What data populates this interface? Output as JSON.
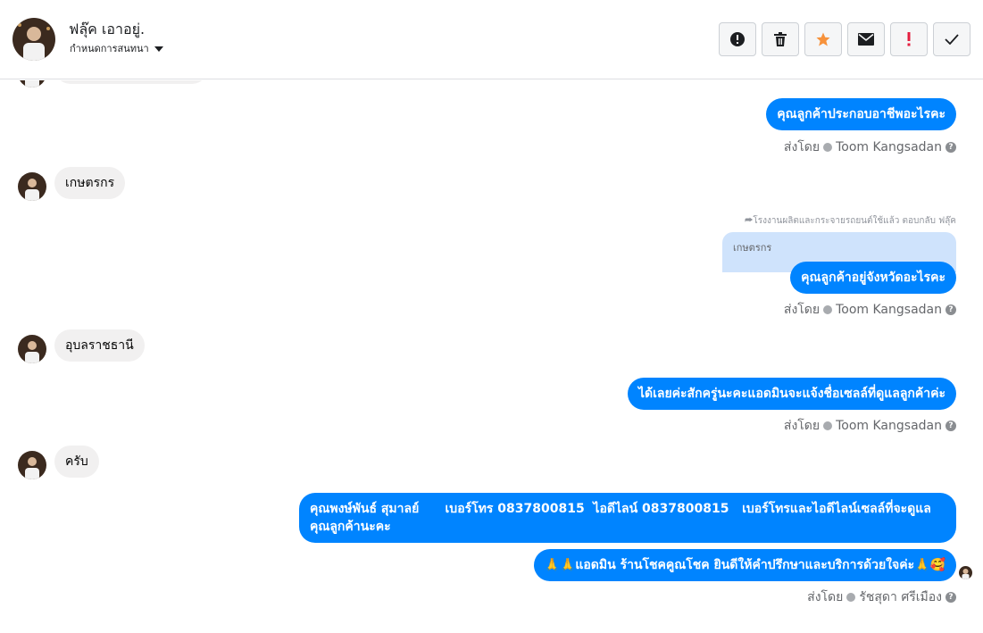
{
  "header": {
    "contact_name": "ฟลุ๊ค เอาอยู่.",
    "assign_label": "กำหนดการสนทนา"
  },
  "toolbar": {
    "buttons": [
      {
        "icon": "alert-circle-icon",
        "color": "#1c1e21"
      },
      {
        "icon": "trash-icon",
        "color": "#1c1e21"
      },
      {
        "icon": "star-icon",
        "color": "#f7923b"
      },
      {
        "icon": "envelope-icon",
        "color": "#1c1e21"
      },
      {
        "icon": "exclamation-icon",
        "color": "#e41e3f"
      },
      {
        "icon": "checkmark-icon",
        "color": "#1c1e21"
      }
    ]
  },
  "messages": {
    "m1": "คุณลูกค้าประกอบอาชีพอะไรคะ",
    "m1_sent_label": "ส่งโดย",
    "m1_sender": "Toom Kangsadan",
    "m2": "เกษตรกร",
    "m3_reply_meta": "โรงงานผลิตและกระจายรถยนต์ใช้แล้ว ตอบกลับ ฟลุ๊ค",
    "m3_quote": "เกษตรกร",
    "m3": "คุณลูกค้าอยู่จังหวัดอะไรคะ",
    "m3_sent_label": "ส่งโดย",
    "m3_sender": "Toom Kangsadan",
    "m4": "อุบลราชธานี",
    "m5": "ได้เลยค่ะสักครู่นะคะแอดมินจะแจ้งชื่อเซลล์ที่ดูแลลูกค้าค่ะ",
    "m5_sent_label": "ส่งโดย",
    "m5_sender": "Toom Kangsadan",
    "m6": "ครับ",
    "m7_line1": "คุณพงษ์พันธ์ สุมาลย์      เบอร์โทร 0837800815  ไอดีไลน์ 0837800815   เบอร์โทรและไอดีไลน์เซลล์ที่จะดูแล",
    "m7_line2": "คุณลูกค้านะคะ",
    "m8": "🙏🙏แอดมิน ร้านโชคคูณโชค ยินดีให้คำปรึกษาและบริการด้วยใจค่ะ🙏🥰",
    "m8_sent_label": "ส่งโดย",
    "m8_sender": "รัชสุดา ศรีเมือง"
  }
}
